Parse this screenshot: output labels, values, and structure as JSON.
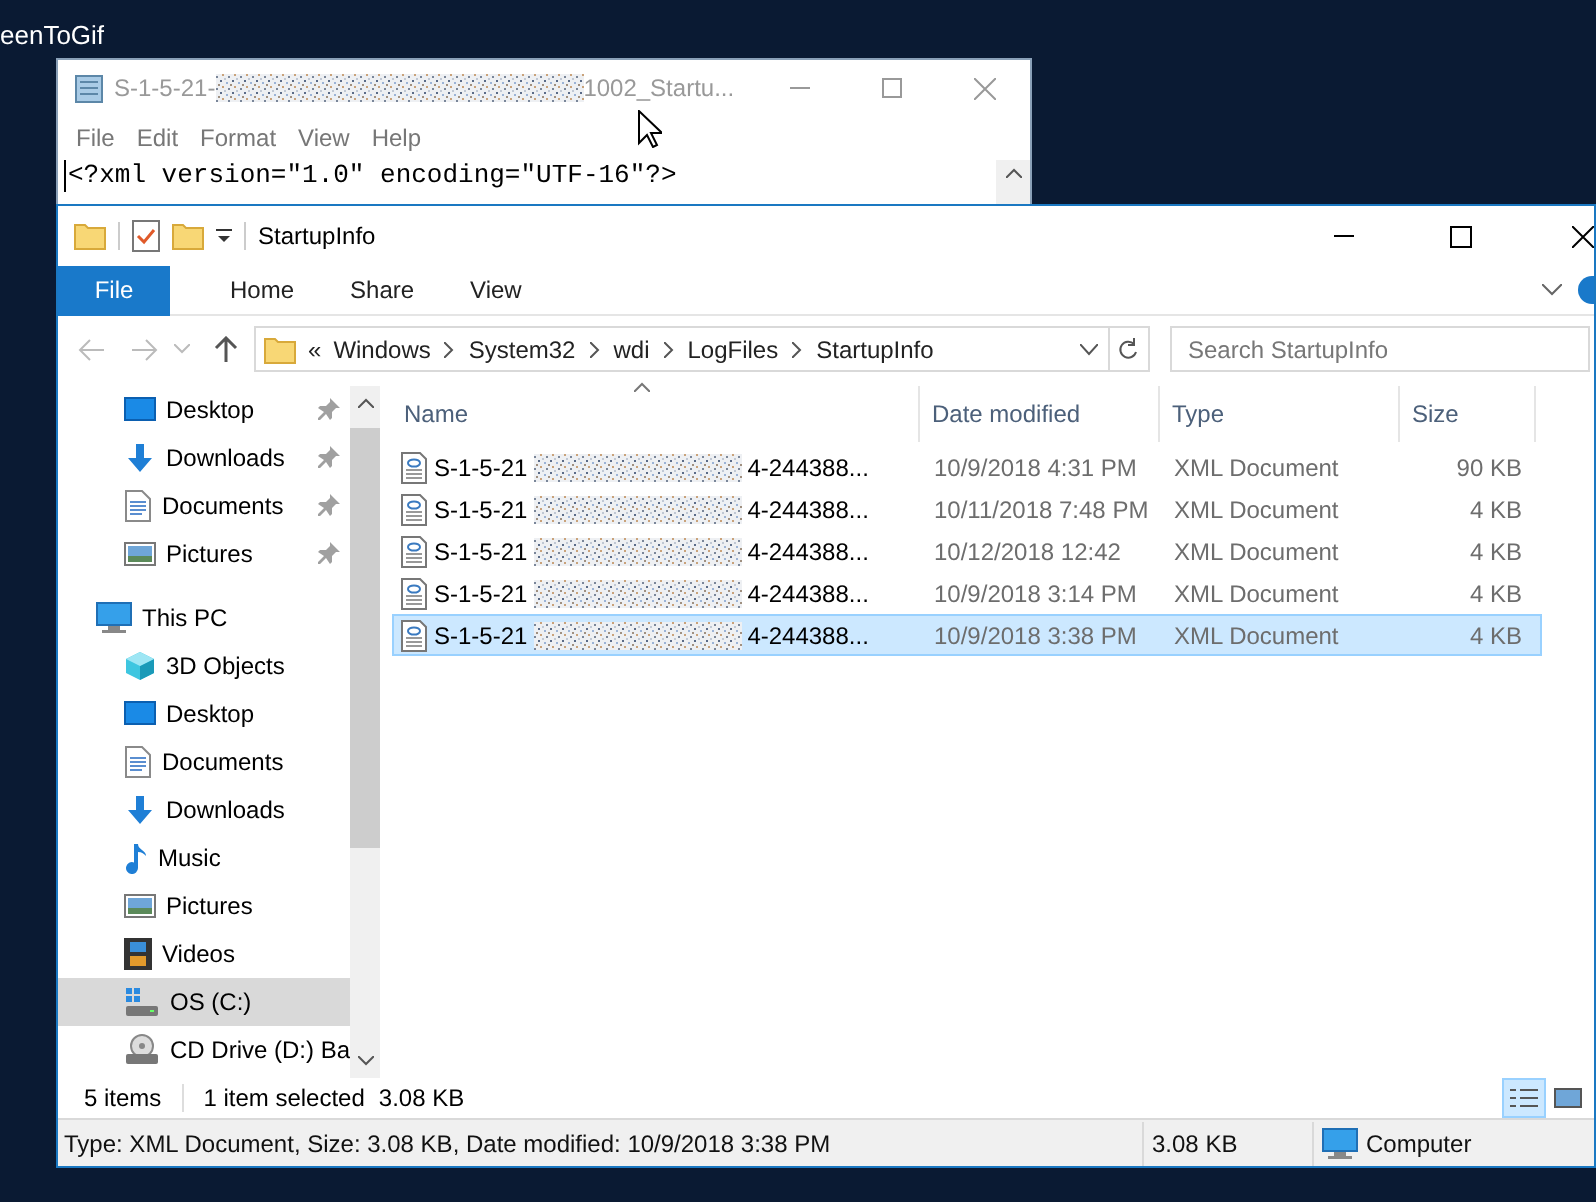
{
  "desktop": {
    "caption": "eenToGif"
  },
  "notepad": {
    "title_prefix": "S-1-5-21-",
    "title_suffix": "1002_Startu...",
    "menu": [
      "File",
      "Edit",
      "Format",
      "View",
      "Help"
    ],
    "lines": [
      "<?xml version=\"1.0\" encoding=\"UTF-16\"?>"
    ]
  },
  "explorer": {
    "title": "StartupInfo",
    "ribbon_tabs": [
      {
        "label": "File",
        "selected": true
      },
      {
        "label": "Home",
        "selected": false
      },
      {
        "label": "Share",
        "selected": false
      },
      {
        "label": "View",
        "selected": false
      }
    ],
    "breadcrumb": [
      "«",
      "Windows",
      "System32",
      "wdi",
      "LogFiles",
      "StartupInfo"
    ],
    "search": {
      "placeholder": "Search StartupInfo"
    },
    "sidebar": [
      {
        "label": "Desktop",
        "kind": "desktop",
        "pinned": true,
        "selected": false
      },
      {
        "label": "Downloads",
        "kind": "downloads",
        "pinned": true,
        "selected": false
      },
      {
        "label": "Documents",
        "kind": "documents",
        "pinned": true,
        "selected": false
      },
      {
        "label": "Pictures",
        "kind": "pictures",
        "pinned": true,
        "selected": false
      },
      {
        "label": "This PC",
        "kind": "pc",
        "pinned": false,
        "selected": false,
        "children": [
          {
            "label": "3D Objects",
            "kind": "objects",
            "pinned": false,
            "selected": false
          },
          {
            "label": "Desktop",
            "kind": "desktop",
            "pinned": false,
            "selected": false
          },
          {
            "label": "Documents",
            "kind": "documents",
            "pinned": false,
            "selected": false
          },
          {
            "label": "Downloads",
            "kind": "downloads",
            "pinned": false,
            "selected": false
          },
          {
            "label": "Music",
            "kind": "music",
            "pinned": false,
            "selected": false
          },
          {
            "label": "Pictures",
            "kind": "pictures",
            "pinned": false,
            "selected": false
          },
          {
            "label": "Videos",
            "kind": "videos",
            "pinned": false,
            "selected": false
          },
          {
            "label": "OS (C:)",
            "kind": "drive",
            "pinned": false,
            "selected": true
          },
          {
            "label": "CD Drive (D:) Ba",
            "kind": "cd",
            "pinned": false,
            "selected": false
          }
        ]
      }
    ],
    "columns": [
      "Name",
      "Date modified",
      "Type",
      "Size"
    ],
    "files": [
      {
        "name_prefix": "S-1-5-21",
        "name_suffix": "4-244388...",
        "date": "10/9/2018 4:31 PM",
        "type": "XML Document",
        "size": "90 KB",
        "selected": false
      },
      {
        "name_prefix": "S-1-5-21",
        "name_suffix": "4-244388...",
        "date": "10/11/2018 7:48 PM",
        "type": "XML Document",
        "size": "4 KB",
        "selected": false
      },
      {
        "name_prefix": "S-1-5-21",
        "name_suffix": "4-244388...",
        "date": "10/12/2018 12:42",
        "type": "XML Document",
        "size": "4 KB",
        "selected": false
      },
      {
        "name_prefix": "S-1-5-21",
        "name_suffix": "4-244388...",
        "date": "10/9/2018 3:14 PM",
        "type": "XML Document",
        "size": "4 KB",
        "selected": false
      },
      {
        "name_prefix": "S-1-5-21",
        "name_suffix": "4-244388...",
        "date": "10/9/2018 3:38 PM",
        "type": "XML Document",
        "size": "4 KB",
        "selected": true
      }
    ],
    "status": {
      "count": "5 items",
      "selection": "1 item selected",
      "selection_size": "3.08 KB"
    },
    "details_bar": {
      "description": "Type: XML Document, Size: 3.08 KB, Date modified: 10/9/2018 3:38 PM",
      "size": "3.08 KB",
      "location": "Computer"
    }
  }
}
